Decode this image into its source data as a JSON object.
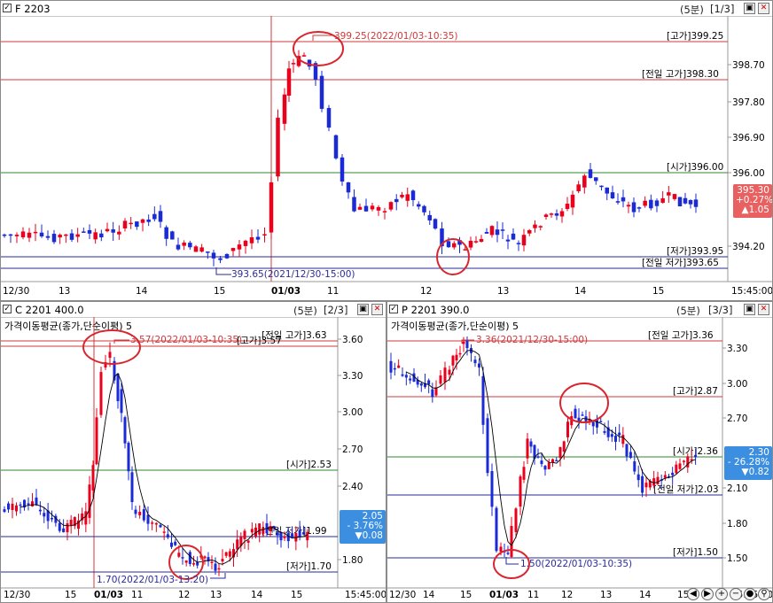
{
  "colors": {
    "up": "#e8001c",
    "down": "#1a2ad6",
    "red_line": "#d0383c",
    "green_line": "#2f8a2f",
    "blue_line": "#2a2a99",
    "tag_red": "#e86060",
    "tag_blue": "#3c8fe0"
  },
  "panels": {
    "main": {
      "title": "F 2203",
      "period": "(5분)",
      "index": "[1/3]",
      "levels": [
        {
          "label": "[고가]399.25",
          "type": "red"
        },
        {
          "label": "[전일 고가]398.30",
          "type": "red"
        },
        {
          "label": "[시가]396.00",
          "type": "green"
        },
        {
          "label": "[저가]393.95",
          "type": "blue"
        },
        {
          "label": "[전일 저가]393.65",
          "type": "blue"
        }
      ],
      "y_ticks": [
        "398.70",
        "397.80",
        "396.90",
        "396.00",
        "394.20"
      ],
      "x_ticks": [
        "12/30",
        "13",
        "14",
        "15",
        "01/03",
        "11",
        "12",
        "13",
        "14",
        "15",
        "15:45:00"
      ],
      "annotations": {
        "high": "399.25(2022/01/03-10:35)",
        "low": "393.65(2021/12/30-15:00)"
      },
      "tag": {
        "price": "395.30",
        "pct": "+0.27%",
        "chg": "▲1.05"
      }
    },
    "call": {
      "title": "C 2201 400.0",
      "period": "(5분)",
      "index": "[2/3]",
      "ma_label": "가격이동평균(종가,단순이평) 5",
      "levels": [
        {
          "label": "[전일 고가]3.63",
          "type": "red"
        },
        {
          "label": "[고가]3.57",
          "type": "red"
        },
        {
          "label": "[시가]2.53",
          "type": "green"
        },
        {
          "label": "[전일 저가]1.99",
          "type": "blue"
        },
        {
          "label": "[저가]1.70",
          "type": "blue"
        }
      ],
      "y_ticks": [
        "3.60",
        "3.30",
        "3.00",
        "2.70",
        "2.40",
        "1.80"
      ],
      "x_ticks": [
        "12/30",
        "15",
        "01/03",
        "11",
        "12",
        "13",
        "14",
        "15",
        "15:45:00"
      ],
      "annotations": {
        "high": "3.57(2022/01/03-10:35)",
        "low": "1.70(2022/01/03-13:20)"
      },
      "tag": {
        "price": "2.05",
        "pct": "- 3.76%",
        "chg": "▼0.08"
      }
    },
    "put": {
      "title": "P 2201 390.0",
      "period": "(5분)",
      "index": "[3/3]",
      "ma_label": "가격이동평균(종가,단순이평) 5",
      "levels": [
        {
          "label": "[전일 고가]3.36",
          "type": "red"
        },
        {
          "label": "[고가]2.87",
          "type": "red"
        },
        {
          "label": "[시가]2.36",
          "type": "green"
        },
        {
          "label": "[전일 저가]2.03",
          "type": "blue"
        },
        {
          "label": "[저가]1.50",
          "type": "blue"
        }
      ],
      "y_ticks": [
        "3.30",
        "3.00",
        "2.70",
        "2.10",
        "1.80",
        "1.50"
      ],
      "x_ticks": [
        "12/30",
        "14",
        "15",
        "01/03",
        "11",
        "12",
        "13",
        "14",
        "15",
        "15:45:00"
      ],
      "annotations": {
        "high": "3.36(2021/12/30-15:00)",
        "low": "1.50(2022/01/03-10:35)"
      },
      "tag": {
        "price": "2.30",
        "pct": "- 26.28%",
        "chg": "▼0.82"
      }
    }
  },
  "icons": {
    "checkbox": "checkbox-icon",
    "settings": "settings-icon",
    "close": "close-icon",
    "zoom_in": "zoom-in-icon",
    "zoom_out": "zoom-out-icon"
  }
}
